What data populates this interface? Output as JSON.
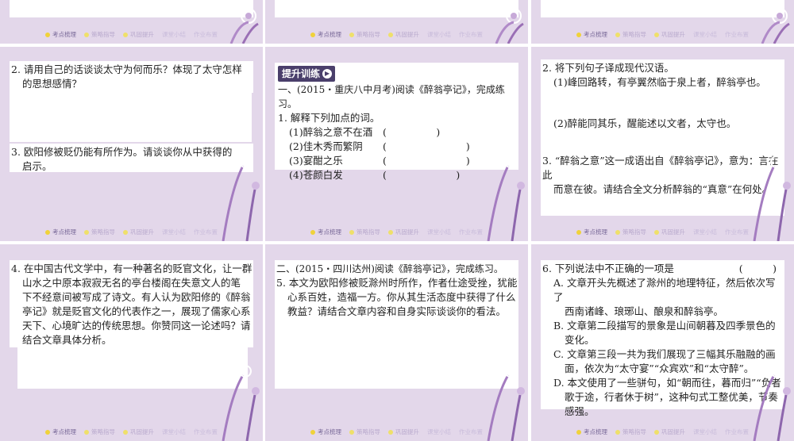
{
  "footer": {
    "nav1": "考点梳理",
    "nav2": "策略指导",
    "nav3": "巩固提升",
    "nav4": "课堂小结",
    "nav5": "作业布置"
  },
  "s1": {},
  "s2": {},
  "s3": {},
  "s4": {
    "q2_line1": "2. 请用自己的话谈谈太守为何而乐？体现了太守怎样",
    "q2_line2": "的思想感情？",
    "q3_line1": "3. 欧阳修被贬仍能有所作为。请谈谈你从中获得的",
    "q3_line2": "启示。"
  },
  "s5": {
    "badge": "提升训练",
    "intro": "一、(2015・重庆八中月考)阅读《醉翁亭记》，完成练习。",
    "q1": "1. 解释下列加点的词。",
    "items": [
      {
        "word": "(1)醉翁之意不在酒",
        "blank": "(　　　　　)"
      },
      {
        "word": "(2)佳木秀而繁阴",
        "blank": "(　　　　　　　　)"
      },
      {
        "word": "(3)宴酣之乐",
        "blank": "(　　　　　　　　)"
      },
      {
        "word": "(4)苍颜白发",
        "blank": "(　　　　　　　)"
      }
    ]
  },
  "s6": {
    "q2": "2. 将下列句子译成现代汉语。",
    "s1": "(1)峰回路转，有亭翼然临于泉上者，醉翁亭也。",
    "s2": "(2)醉能同其乐，醒能述以文者，太守也。",
    "q3_line1": "3. “醉翁之意”这一成语出自《醉翁亭记》，意为：言在此",
    "q3_line2": "而意在彼。请结合全文分析醉翁的“真意”在何处。"
  },
  "s7": {
    "lines": [
      "4. 在中国古代文学中，有一种著名的贬官文化，让一群",
      "山水之中原本寂寂无名的亭台楼阁在失意文人的笔",
      "下不经意间被写成了诗文。有人认为欧阳修的《醉翁",
      "亭记》就是贬官文化的代表作之一，展现了儒家心系",
      "天下、心境旷达的传统思想。你赞同这一论述吗？请",
      "结合文章具体分析。"
    ]
  },
  "s8": {
    "intro": "二、(2015・四川达州)阅读《醉翁亭记》，完成练习。",
    "lines": [
      "5. 本文为欧阳修被贬滁州时所作，作者仕途受挫，犹能",
      "心系百姓，造福一方。你从其生活态度中获得了什么",
      "教益？请结合文章内容和自身实际谈谈你的看法。"
    ]
  },
  "s9": {
    "q6": "6. 下列说法中不正确的一项是",
    "paren": "(　　　)",
    "opts": [
      "A. 文章开头先概述了滁州的地理特征，然后依次写了",
      "西南诸峰、琅琊山、酿泉和醉翁亭。",
      "B. 文章第二段描写的景象是山间朝暮及四季景色的",
      "变化。",
      "C. 文章第三段一共为我们展现了三幅其乐融融的画",
      "面，依次为“太守宴”“众宾欢”和“太守醉”。",
      "D. 本文使用了一些骈句，如“朝而往，暮而归”“负者",
      "歌于途，行者休于树”，这种句式工整优美，节奏",
      "感强。"
    ]
  }
}
